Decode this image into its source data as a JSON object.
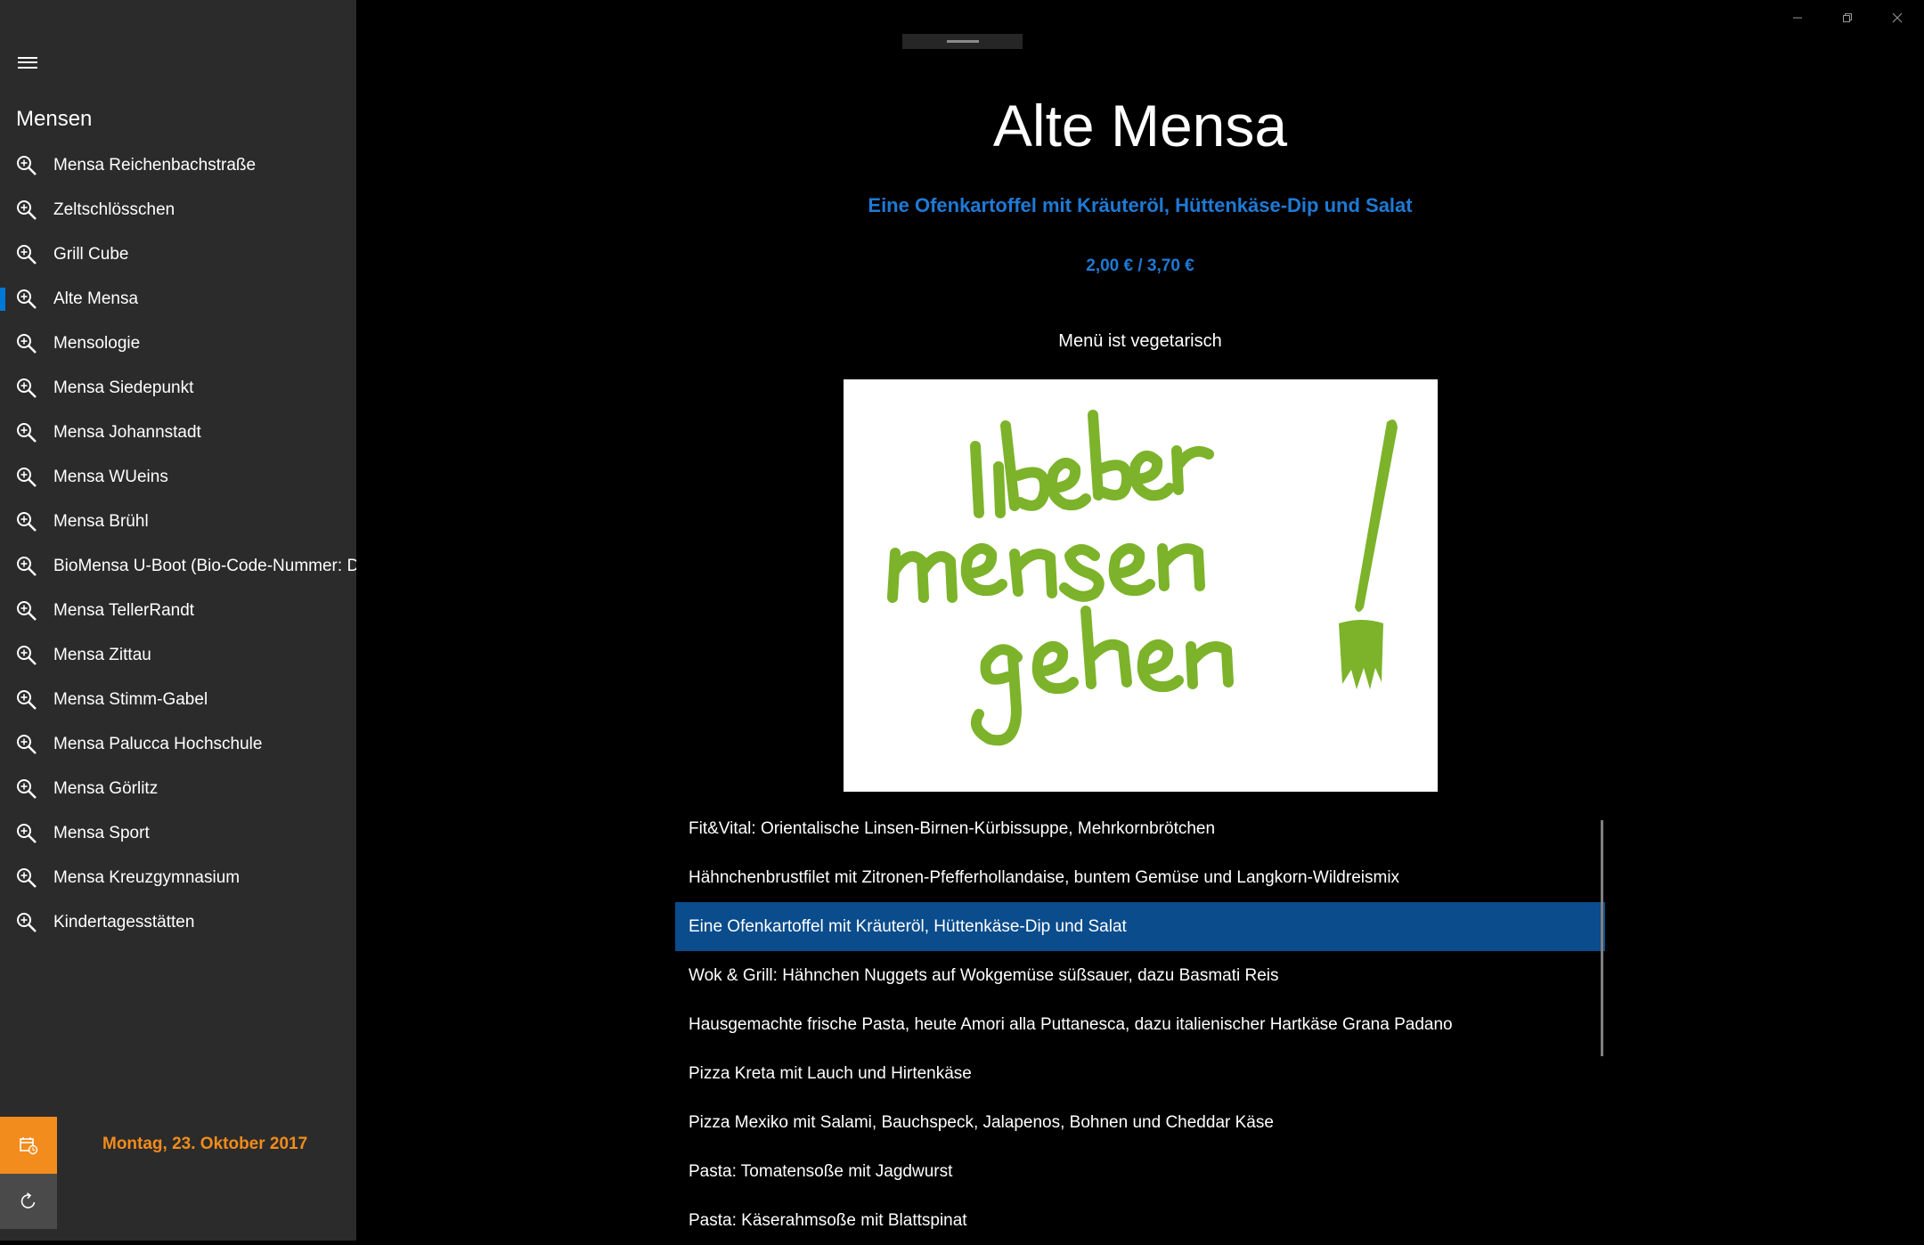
{
  "nav": {
    "title": "Mensen",
    "items": [
      {
        "label": "Mensa Reichenbachstraße",
        "icon": "search-icon"
      },
      {
        "label": "Zeltschlösschen",
        "icon": "search-icon"
      },
      {
        "label": "Grill Cube",
        "icon": "search-icon"
      },
      {
        "label": "Alte Mensa",
        "icon": "search-icon",
        "active": true
      },
      {
        "label": "Mensologie",
        "icon": "search-icon"
      },
      {
        "label": "Mensa Siedepunkt",
        "icon": "search-icon"
      },
      {
        "label": "Mensa Johannstadt",
        "icon": "search-icon"
      },
      {
        "label": "Mensa WUeins",
        "icon": "search-icon"
      },
      {
        "label": "Mensa Brühl",
        "icon": "search-icon"
      },
      {
        "label": "BioMensa U-Boot (Bio-Code-Nummer: DE",
        "icon": "search-icon"
      },
      {
        "label": "Mensa TellerRandt",
        "icon": "search-icon"
      },
      {
        "label": "Mensa Zittau",
        "icon": "search-icon"
      },
      {
        "label": "Mensa Stimm-Gabel",
        "icon": "search-icon"
      },
      {
        "label": "Mensa Palucca Hochschule",
        "icon": "search-icon"
      },
      {
        "label": "Mensa Görlitz",
        "icon": "search-icon"
      },
      {
        "label": "Mensa Sport",
        "icon": "search-icon"
      },
      {
        "label": "Mensa Kreuzgymnasium",
        "icon": "search-icon"
      },
      {
        "label": "Kindertagesstätten",
        "icon": "search-icon"
      }
    ],
    "date": "Montag, 23. Oktober 2017"
  },
  "main": {
    "title": "Alte Mensa",
    "meal_name": "Eine Ofenkartoffel mit Kräuteröl, Hüttenkäse-Dip und Salat",
    "price": "2,00 € / 3,70 €",
    "note": "Menü ist vegetarisch",
    "image_logo_text": "lieber mensen gehen!",
    "meals": [
      {
        "label": "Fit&Vital: Orientalische Linsen-Birnen-Kürbissuppe, Mehrkornbrötchen"
      },
      {
        "label": "Hähnchenbrustfilet mit Zitronen-Pfefferhollandaise, buntem Gemüse und Langkorn-Wildreismix"
      },
      {
        "label": "Eine Ofenkartoffel mit Kräuteröl, Hüttenkäse-Dip und Salat",
        "selected": true
      },
      {
        "label": "Wok & Grill: Hähnchen Nuggets auf Wokgemüse süßsauer, dazu Basmati Reis"
      },
      {
        "label": "Hausgemachte frische Pasta, heute Amori alla Puttanesca, dazu italienischer Hartkäse Grana Padano"
      },
      {
        "label": "Pizza Kreta mit Lauch und Hirtenkäse"
      },
      {
        "label": "Pizza Mexiko mit Salami, Bauchspeck, Jalapenos, Bohnen und Cheddar Käse"
      },
      {
        "label": "Pasta: Tomatensoße mit Jagdwurst"
      },
      {
        "label": "Pasta: Käserahmsoße mit Blattspinat"
      }
    ]
  },
  "colors": {
    "accent": "#1e7ad6",
    "selected_bg": "#0a4c8c",
    "date_accent": "#f28c1c",
    "logo_green": "#7cb32a",
    "sidebar_bg": "#2b2b2b"
  }
}
